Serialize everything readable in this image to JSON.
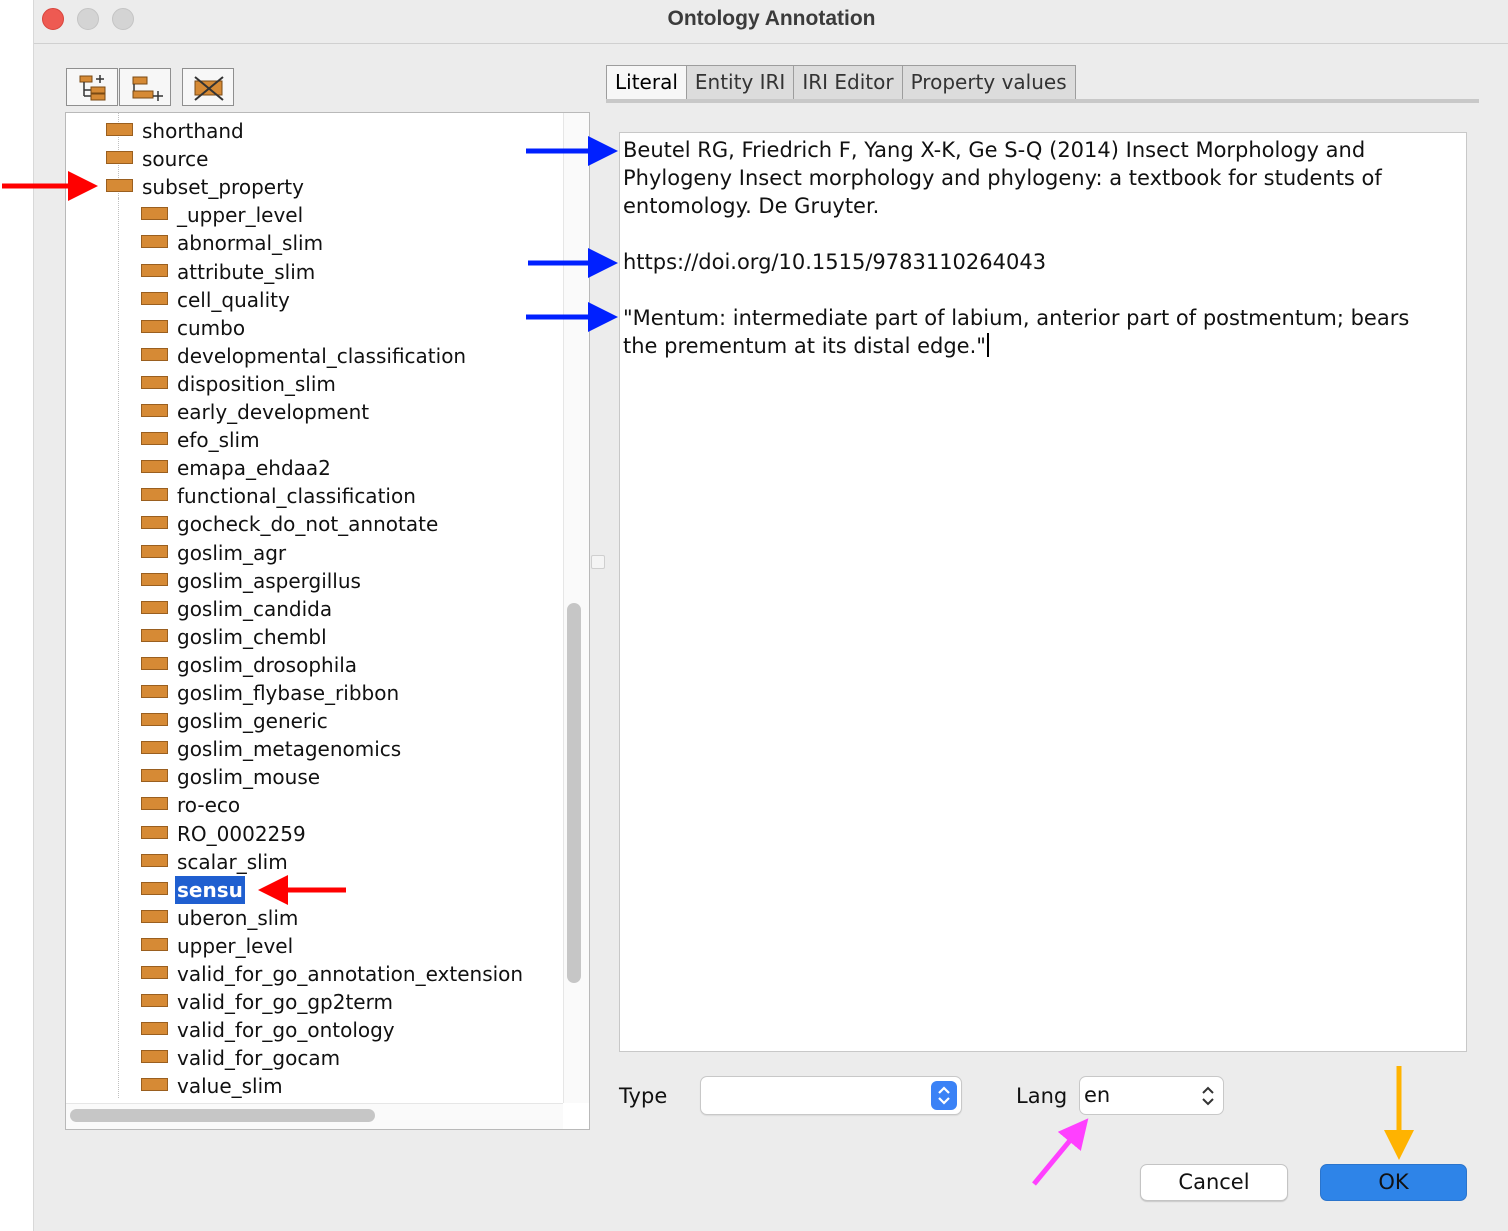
{
  "window": {
    "title": "Ontology Annotation"
  },
  "toolbar": {
    "buttons": [
      {
        "icon": "add-sub-property-icon"
      },
      {
        "icon": "add-sibling-property-icon"
      },
      {
        "icon": "delete-property-icon"
      }
    ]
  },
  "tree": {
    "parent_items": [
      "shorthand",
      "source",
      "subset_property"
    ],
    "child_items": [
      "_upper_level",
      "abnormal_slim",
      "attribute_slim",
      "cell_quality",
      "cumbo",
      "developmental_classification",
      "disposition_slim",
      "early_development",
      "efo_slim",
      "emapa_ehdaa2",
      "functional_classification",
      "gocheck_do_not_annotate",
      "goslim_agr",
      "goslim_aspergillus",
      "goslim_candida",
      "goslim_chembl",
      "goslim_drosophila",
      "goslim_flybase_ribbon",
      "goslim_generic",
      "goslim_metagenomics",
      "goslim_mouse",
      "ro-eco",
      "RO_0002259",
      "scalar_slim",
      "sensu",
      "uberon_slim",
      "upper_level",
      "valid_for_go_annotation_extension",
      "valid_for_go_gp2term",
      "valid_for_go_ontology",
      "valid_for_gocam",
      "value_slim"
    ],
    "selected": "sensu"
  },
  "tabs": [
    "Literal",
    "Entity IRI",
    "IRI Editor",
    "Property values"
  ],
  "active_tab": "Literal",
  "literal": {
    "paragraphs": [
      "Beutel RG, Friedrich F, Yang X-K, Ge S-Q (2014) Insect Morphology and\nPhylogeny Insect morphology and phylogeny: a textbook for students of\nentomology. De Gruyter.",
      "https://doi.org/10.1515/9783110264043",
      "\"Mentum: intermediate part of labium, anterior part of postmentum; bears\nthe prementum at its distal edge.\""
    ]
  },
  "form": {
    "type_label": "Type",
    "type_value": "",
    "lang_label": "Lang",
    "lang_value": "en"
  },
  "buttons": {
    "cancel": "Cancel",
    "ok": "OK"
  },
  "colors": {
    "accent_blue": "#2e84e8",
    "selection": "#1f5fd0",
    "property_icon": "#d68a35",
    "annotation_red": "#ff0000",
    "annotation_blue": "#0020ff",
    "annotation_magenta": "#ff40ff",
    "annotation_orange": "#ffb300"
  }
}
